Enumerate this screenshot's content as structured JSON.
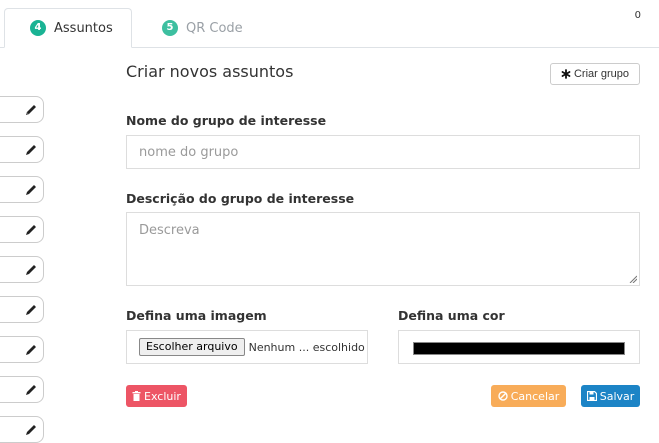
{
  "tabs": [
    {
      "number": "4",
      "label": "Assuntos",
      "active": true
    },
    {
      "number": "5",
      "label": "QR Code",
      "active": false
    }
  ],
  "counter": "0",
  "sidebar_edit_items": [
    {
      "icon": "pencil-icon"
    },
    {
      "icon": "pencil-icon"
    },
    {
      "icon": "pencil-icon"
    },
    {
      "icon": "pencil-icon"
    },
    {
      "icon": "pencil-icon"
    },
    {
      "icon": "pencil-icon"
    },
    {
      "icon": "pencil-icon"
    },
    {
      "icon": "pencil-icon"
    },
    {
      "icon": "pencil-icon"
    }
  ],
  "form": {
    "title": "Criar novos assuntos",
    "new_group_button": {
      "icon": "asterisk-icon",
      "label": "Criar grupo"
    },
    "name_label": "Nome do grupo de interesse",
    "name_placeholder": "nome do grupo",
    "description_label": "Descrição do grupo de interesse",
    "description_placeholder": "Descreva",
    "image_label": "Defina uma imagem",
    "file_button_label": "Escolher arquivo",
    "file_status": "Nenhum ... escolhido",
    "color_label": "Defina uma cor",
    "color_value": "#000000"
  },
  "actions": {
    "delete": {
      "icon": "trash-icon",
      "label": "Excluir",
      "color": "#ed5565"
    },
    "cancel": {
      "icon": "ban-icon",
      "label": "Cancelar",
      "color": "#f8ac59"
    },
    "save": {
      "icon": "floppy-disk-icon",
      "label": "Salvar",
      "color": "#1c84c6"
    }
  },
  "colors": {
    "badge": "#1ab394",
    "border": "#dee2e6"
  }
}
